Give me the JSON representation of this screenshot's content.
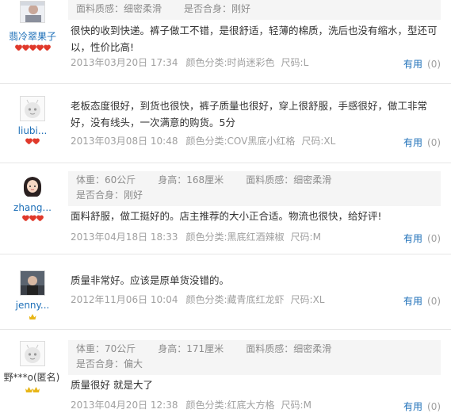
{
  "labels": {
    "useful": "有用",
    "useful_count": "(0)"
  },
  "reviews": [
    {
      "user": "翡冷翠果子",
      "attrs": [
        "面料质感：细密柔滑",
        "是否合身：刚好"
      ],
      "content": "很快的收到快递。裤子做工不错，是很舒适，轻薄的棉质，洗后也没有缩水，型还可以，性价比高!",
      "date": "2013年03月20日 17:34",
      "color": "颜色分类:时尚迷彩色",
      "size": "尺码:L"
    },
    {
      "user": "liubi...",
      "attrs": [],
      "content": "老板态度很好，到货也很快，裤子质量也很好，穿上很舒服，手感很好，做工非常好，没有线头，一次满意的购货。5分",
      "date": "2013年03月08日 10:48",
      "color": "颜色分类:COV黑底小红格",
      "size": "尺码:XL"
    },
    {
      "user": "zhang...",
      "attrs": [
        "体重：60公斤",
        "身高：168厘米",
        "面料质感：细密柔滑",
        "是否合身：刚好"
      ],
      "content": "面料舒服，做工挺好的。店主推荐的大小正合适。物流也很快，给好评!",
      "date": "2013年04月18日 18:33",
      "color": "颜色分类:黑底红酒辣椒",
      "size": "尺码:M"
    },
    {
      "user": "jenny...",
      "attrs": [],
      "content": "质量非常好。应该是原单货没错的。",
      "date": "2012年11月06日 10:04",
      "color": "颜色分类:藏青底红龙虾",
      "size": "尺码:XL"
    },
    {
      "user": "野***o(匿名)",
      "attrs": [
        "体重：70公斤",
        "身高：171厘米",
        "面料质感：细密柔滑",
        "是否合身：偏大"
      ],
      "content": "质量很好 就是大了",
      "date": "2013年04月20日 12:38",
      "color": "颜色分类:红底大方格",
      "size": "尺码:M"
    }
  ]
}
